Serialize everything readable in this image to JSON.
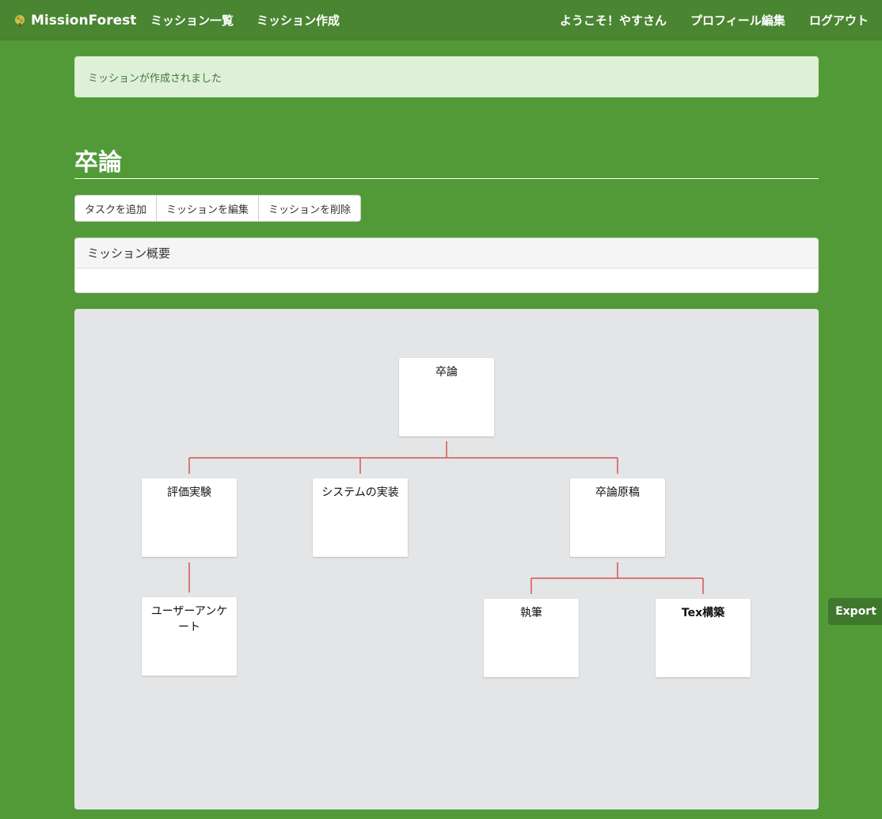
{
  "navbar": {
    "brand": "MissionForest",
    "links": {
      "mission_list": "ミッション一覧",
      "mission_create": "ミッション作成",
      "welcome": "ようこそ！やすさん",
      "profile_edit": "プロフィール編集",
      "logout": "ログアウト"
    }
  },
  "alert": {
    "message": "ミッションが作成されました"
  },
  "page": {
    "title": "卒論"
  },
  "actions": {
    "add_task": "タスクを追加",
    "edit_mission": "ミッションを編集",
    "delete_mission": "ミッションを削除"
  },
  "panel": {
    "heading": "ミッション概要",
    "body": ""
  },
  "tree": {
    "line_color": "#d9534f",
    "root": {
      "label": "卒論"
    },
    "evaluation": {
      "label": "評価実験"
    },
    "system_impl": {
      "label": "システムの実装"
    },
    "thesis_draft": {
      "label": "卒論原稿"
    },
    "user_survey": {
      "label": "ユーザーアンケート"
    },
    "writing": {
      "label": "執筆"
    },
    "tex_build": {
      "label": "Tex構築"
    }
  },
  "export_label": "Export"
}
